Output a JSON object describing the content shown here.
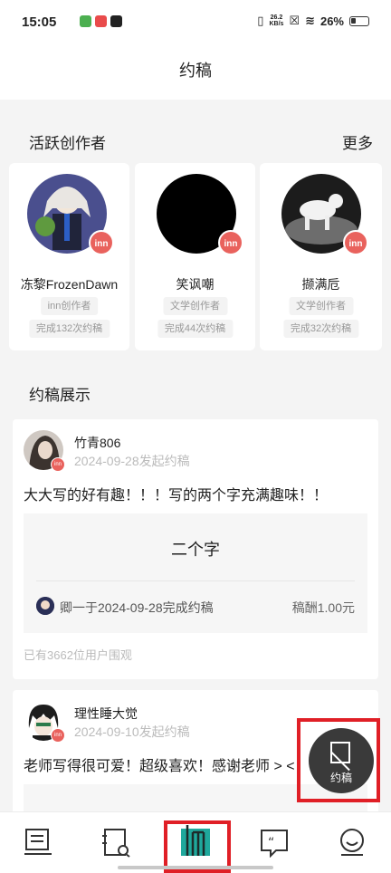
{
  "status_bar": {
    "time": "15:05",
    "speed_value": "26.2",
    "speed_unit": "KB/s",
    "battery": "26%"
  },
  "page": {
    "title": "约稿"
  },
  "active_creators": {
    "title": "活跃创作者",
    "more": "更多",
    "items": [
      {
        "name": "冻黎FrozenDawn",
        "tag": "inn创作者",
        "stats": "完成132次约稿",
        "badge": "inn"
      },
      {
        "name": "笑讽嘲",
        "tag": "文学创作者",
        "stats": "完成44次约稿",
        "badge": "inn"
      },
      {
        "name": "撷满卮",
        "tag": "文学创作者",
        "stats": "完成32次约稿",
        "badge": "inn"
      }
    ]
  },
  "showcase": {
    "title": "约稿展示",
    "posts": [
      {
        "user": "竹青806",
        "date": "2024-09-28发起约稿",
        "badge": "inn",
        "body": "大大写的好有趣！！！写的两个字充满趣味！！",
        "work_title": "二个字",
        "completed_by": "卿一于2024-09-28完成约稿",
        "fee": "稿酬1.00元",
        "views": "已有3662位用户围观"
      },
      {
        "user": "理性睡大觉",
        "date": "2024-09-10发起约稿",
        "badge": "inn",
        "body": "老师写得很可爱！超级喜欢！感谢老师 > <"
      }
    ]
  },
  "fab": {
    "label": "约稿"
  },
  "bottom_nav": [
    {
      "icon": "document-stack-icon"
    },
    {
      "icon": "notebook-search-icon"
    },
    {
      "icon": "inn-logo-icon"
    },
    {
      "icon": "quote-bubble-icon"
    },
    {
      "icon": "smiley-profile-icon"
    }
  ],
  "colors": {
    "accent": "#e9625d",
    "active_nav": "#1fa89c",
    "highlight": "#e01f26"
  }
}
